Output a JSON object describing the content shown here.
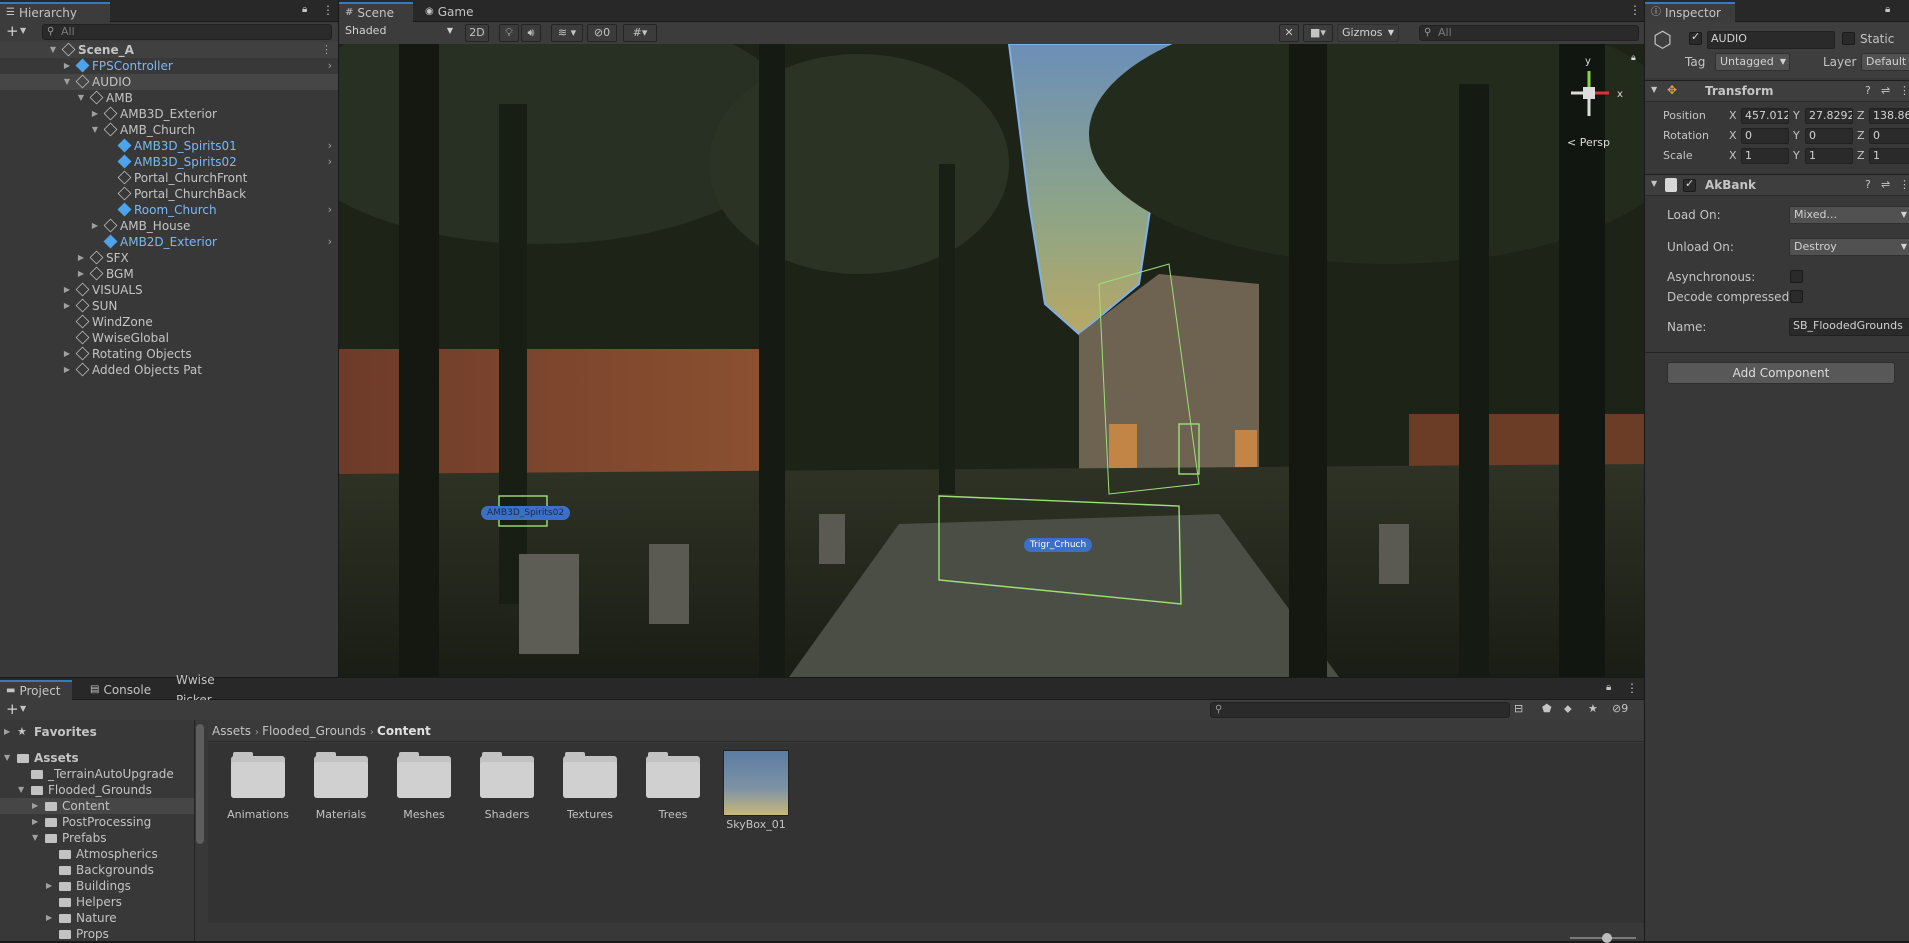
{
  "hierarchy": {
    "tab_label": "Hierarchy",
    "search_placeholder": "All",
    "add_label": "+",
    "rows": [
      {
        "label": "Scene_A",
        "depth": 0,
        "arrow": "▼",
        "type": "scene",
        "bold": true
      },
      {
        "label": "FPSController",
        "depth": 1,
        "arrow": "▶",
        "type": "prefab",
        "more": true
      },
      {
        "label": "AUDIO",
        "depth": 1,
        "arrow": "▼",
        "type": "object",
        "selected": true
      },
      {
        "label": "AMB",
        "depth": 2,
        "arrow": "▼",
        "type": "object"
      },
      {
        "label": "AMB3D_Exterior",
        "depth": 3,
        "arrow": "▶",
        "type": "object"
      },
      {
        "label": "AMB_Church",
        "depth": 3,
        "arrow": "▼",
        "type": "object"
      },
      {
        "label": "AMB3D_Spirits01",
        "depth": 4,
        "arrow": "",
        "type": "prefab",
        "more": true
      },
      {
        "label": "AMB3D_Spirits02",
        "depth": 4,
        "arrow": "",
        "type": "prefab",
        "more": true
      },
      {
        "label": "Portal_ChurchFront",
        "depth": 4,
        "arrow": "",
        "type": "object"
      },
      {
        "label": "Portal_ChurchBack",
        "depth": 4,
        "arrow": "",
        "type": "object"
      },
      {
        "label": "Room_Church",
        "depth": 4,
        "arrow": "",
        "type": "prefab",
        "more": true
      },
      {
        "label": "AMB_House",
        "depth": 3,
        "arrow": "▶",
        "type": "object"
      },
      {
        "label": "AMB2D_Exterior",
        "depth": 3,
        "arrow": "",
        "type": "prefab",
        "more": true
      },
      {
        "label": "SFX",
        "depth": 2,
        "arrow": "▶",
        "type": "object"
      },
      {
        "label": "BGM",
        "depth": 2,
        "arrow": "▶",
        "type": "object"
      },
      {
        "label": "VISUALS",
        "depth": 1,
        "arrow": "▶",
        "type": "object"
      },
      {
        "label": "SUN",
        "depth": 1,
        "arrow": "▶",
        "type": "object"
      },
      {
        "label": "WindZone",
        "depth": 1,
        "arrow": "",
        "type": "object"
      },
      {
        "label": "WwiseGlobal",
        "depth": 1,
        "arrow": "",
        "type": "object"
      },
      {
        "label": "Rotating Objects",
        "depth": 1,
        "arrow": "▶",
        "type": "object"
      },
      {
        "label": "Added Objects Pat",
        "depth": 1,
        "arrow": "▶",
        "type": "object"
      }
    ]
  },
  "scene": {
    "tabs": [
      "Scene",
      "Game"
    ],
    "shading_mode": "Shaded",
    "btn_2d": "2D",
    "hidden_count": "0",
    "gizmos_label": "Gizmos",
    "search_placeholder": "All",
    "persp_label": "< Persp",
    "axis_y": "y",
    "axis_x": "x",
    "labels": {
      "spirits": "AMB3D_Spirits02",
      "trigger": "Trigr_Crhuch"
    }
  },
  "inspector": {
    "tab_label": "Inspector",
    "object_name": "AUDIO",
    "static_label": "Static",
    "tag_label": "Tag",
    "tag_value": "Untagged",
    "layer_label": "Layer",
    "layer_value": "Default",
    "transform": {
      "title": "Transform",
      "position_label": "Position",
      "rotation_label": "Rotation",
      "scale_label": "Scale",
      "position": [
        "457.012",
        "27.8292",
        "138.86"
      ],
      "rotation": [
        "0",
        "0",
        "0"
      ],
      "scale": [
        "1",
        "1",
        "1"
      ],
      "axes": [
        "X",
        "Y",
        "Z"
      ]
    },
    "akbank": {
      "title": "AkBank",
      "load_on_label": "Load On:",
      "load_on_value": "Mixed...",
      "unload_on_label": "Unload On:",
      "unload_on_value": "Destroy",
      "async_label": "Asynchronous:",
      "decode_label": "Decode compressed",
      "name_label": "Name:",
      "name_value": "SB_FloodedGrounds"
    },
    "add_component": "Add Component"
  },
  "project": {
    "tabs": [
      "Project",
      "Console",
      "Wwise Picker"
    ],
    "add_label": "+",
    "hidden_count": "9",
    "breadcrumb": [
      "Assets",
      "Flooded_Grounds",
      "Content"
    ],
    "tree": [
      {
        "label": "Favorites",
        "depth": 0,
        "arrow": "▶",
        "icon": "star",
        "bold": true
      },
      {
        "label": "Assets",
        "depth": 0,
        "arrow": "▼",
        "icon": "folder",
        "bold": true
      },
      {
        "label": "_TerrainAutoUpgrade",
        "depth": 1,
        "arrow": "",
        "icon": "folder"
      },
      {
        "label": "Flooded_Grounds",
        "depth": 1,
        "arrow": "▼",
        "icon": "folder"
      },
      {
        "label": "Content",
        "depth": 2,
        "arrow": "▶",
        "icon": "folder",
        "selected": true
      },
      {
        "label": "PostProcessing",
        "depth": 2,
        "arrow": "▶",
        "icon": "folder"
      },
      {
        "label": "Prefabs",
        "depth": 2,
        "arrow": "▼",
        "icon": "folder"
      },
      {
        "label": "Atmospherics",
        "depth": 3,
        "arrow": "",
        "icon": "folder"
      },
      {
        "label": "Backgrounds",
        "depth": 3,
        "arrow": "",
        "icon": "folder"
      },
      {
        "label": "Buildings",
        "depth": 3,
        "arrow": "▶",
        "icon": "folder"
      },
      {
        "label": "Helpers",
        "depth": 3,
        "arrow": "",
        "icon": "folder"
      },
      {
        "label": "Nature",
        "depth": 3,
        "arrow": "▶",
        "icon": "folder"
      },
      {
        "label": "Props",
        "depth": 3,
        "arrow": "",
        "icon": "folder"
      }
    ],
    "items": [
      "Animations",
      "Materials",
      "Meshes",
      "Shaders",
      "Textures",
      "Trees",
      "SkyBox_01"
    ]
  },
  "colors": {
    "accent": "#3a79bb",
    "prefab": "#7cb7f5",
    "panel": "#383838",
    "dark": "#282828"
  }
}
